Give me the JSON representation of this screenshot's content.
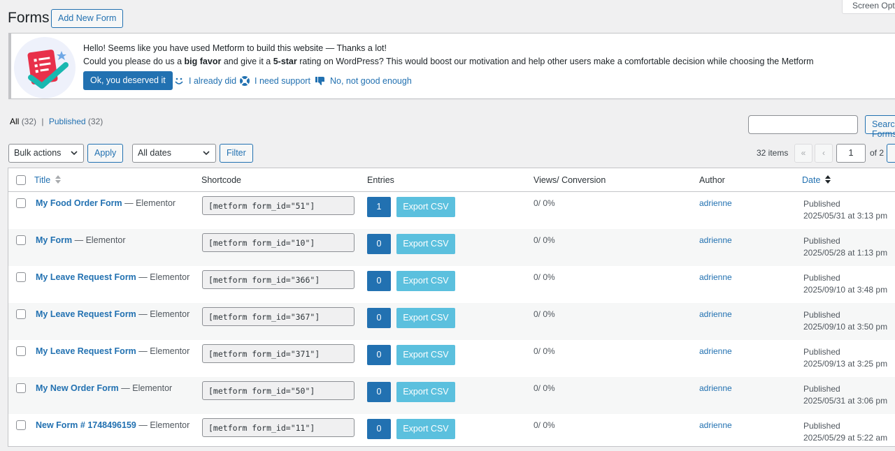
{
  "header": {
    "title": "Forms",
    "add_new_label": "Add New Form",
    "screen_options_label": "Screen Options"
  },
  "notice": {
    "line1": "Hello! Seems like you have used Metform to build this website — Thanks a lot!",
    "line2_a": "Could you please do us a ",
    "line2_b": "big favor",
    "line2_c": " and give it a ",
    "line2_d": "5-star",
    "line2_e": " rating on WordPress? This would boost our motivation and help other users make a comfortable decision while choosing the Metform",
    "primary_button": "Ok, you deserved it",
    "link_already": "I already did",
    "link_support": "I need support",
    "link_not_good": "No, not good enough"
  },
  "filters": {
    "all_label": "All",
    "all_count": "(32)",
    "separator": "|",
    "published_label": "Published",
    "published_count": "(32)",
    "search_value": "",
    "search_button": "Search Forms",
    "bulk_actions": "Bulk actions",
    "apply_label": "Apply",
    "dates_value": "All dates",
    "filter_label": "Filter"
  },
  "pagination": {
    "items": "32 items",
    "first": "«",
    "prev": "‹",
    "current": "1",
    "of_total": "of 2"
  },
  "table": {
    "columns": {
      "title": "Title",
      "shortcode": "Shortcode",
      "entries": "Entries",
      "views": "Views/ Conversion",
      "author": "Author",
      "date": "Date"
    },
    "export_label": "Export CSV",
    "rows": [
      {
        "title": "My Food Order Form",
        "suffix": "Elementor",
        "shortcode": "[metform form_id=\"51\"]",
        "entries": "1",
        "views": "0/ 0%",
        "author": "adrienne",
        "status": "Published",
        "date": "2025/05/31 at 3:13 pm"
      },
      {
        "title": "My Form",
        "suffix": "Elementor",
        "shortcode": "[metform form_id=\"10\"]",
        "entries": "0",
        "views": "0/ 0%",
        "author": "adrienne",
        "status": "Published",
        "date": "2025/05/28 at 1:13 pm"
      },
      {
        "title": "My Leave Request Form",
        "suffix": "Elementor",
        "shortcode": "[metform form_id=\"366\"]",
        "entries": "0",
        "views": "0/ 0%",
        "author": "adrienne",
        "status": "Published",
        "date": "2025/09/10 at 3:48 pm"
      },
      {
        "title": "My Leave Request Form",
        "suffix": "Elementor",
        "shortcode": "[metform form_id=\"367\"]",
        "entries": "0",
        "views": "0/ 0%",
        "author": "adrienne",
        "status": "Published",
        "date": "2025/09/10 at 3:50 pm"
      },
      {
        "title": "My Leave Request Form",
        "suffix": "Elementor",
        "shortcode": "[metform form_id=\"371\"]",
        "entries": "0",
        "views": "0/ 0%",
        "author": "adrienne",
        "status": "Published",
        "date": "2025/09/13 at 3:25 pm"
      },
      {
        "title": "My New Order Form",
        "suffix": "Elementor",
        "shortcode": "[metform form_id=\"50\"]",
        "entries": "0",
        "views": "0/ 0%",
        "author": "adrienne",
        "status": "Published",
        "date": "2025/05/31 at 3:06 pm"
      },
      {
        "title": "New Form # 1748496159",
        "suffix": "Elementor",
        "shortcode": "[metform form_id=\"11\"]",
        "entries": "0",
        "views": "0/ 0%",
        "author": "adrienne",
        "status": "Published",
        "date": "2025/05/29 at 5:22 am"
      }
    ]
  },
  "colors": {
    "primary": "#2271b1",
    "export": "#5bc0de",
    "background": "#f0f0f1"
  }
}
